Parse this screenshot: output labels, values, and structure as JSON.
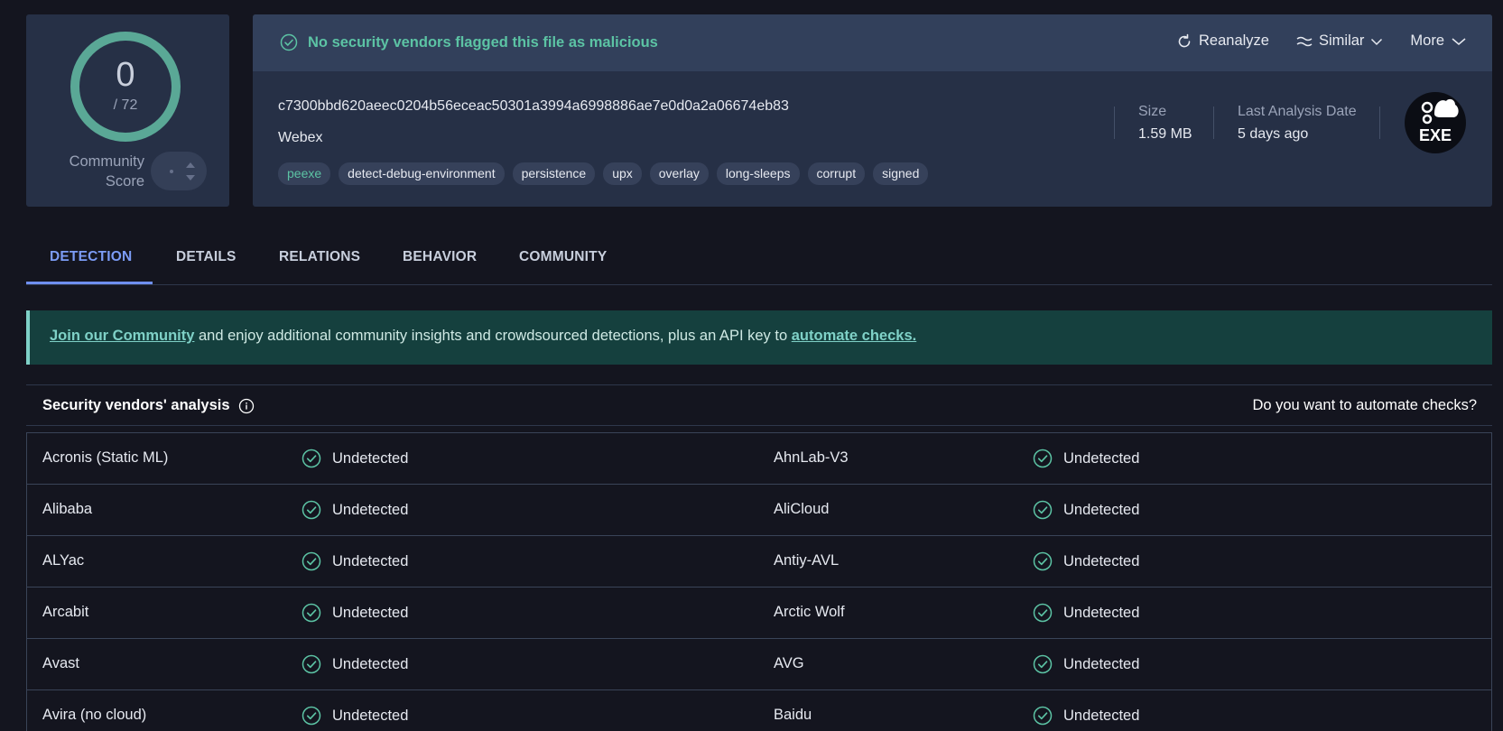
{
  "score": {
    "detections": "0",
    "total": "/ 72",
    "community_label_line1": "Community",
    "community_label_line2": "Score",
    "ring_color": "#5aa896"
  },
  "summary": {
    "status_message": "No security vendors flagged this file as malicious",
    "status_color": "#5cc3a4",
    "actions": {
      "reanalyze": "Reanalyze",
      "similar": "Similar",
      "more": "More"
    },
    "hash": "c7300bbd620aeec0204b56eceac50301a3994a6998886ae7e0d0a2a06674eb83",
    "file_name": "Webex",
    "tags": [
      "peexe",
      "detect-debug-environment",
      "persistence",
      "upx",
      "overlay",
      "long-sleeps",
      "corrupt",
      "signed"
    ],
    "size_label": "Size",
    "size_value": "1.59 MB",
    "date_label": "Last Analysis Date",
    "date_value": "5 days ago",
    "file_type": "EXE"
  },
  "tabs": [
    "DETECTION",
    "DETAILS",
    "RELATIONS",
    "BEHAVIOR",
    "COMMUNITY"
  ],
  "banner": {
    "link1": "Join our Community",
    "middle": " and enjoy additional community insights and crowdsourced detections, plus an API key to ",
    "link2": "automate checks."
  },
  "vendors": {
    "title": "Security vendors' analysis",
    "automate_question": "Do you want to automate checks?",
    "rows": [
      {
        "left_name": "Acronis (Static ML)",
        "left_result": "Undetected",
        "right_name": "AhnLab-V3",
        "right_result": "Undetected"
      },
      {
        "left_name": "Alibaba",
        "left_result": "Undetected",
        "right_name": "AliCloud",
        "right_result": "Undetected"
      },
      {
        "left_name": "ALYac",
        "left_result": "Undetected",
        "right_name": "Antiy-AVL",
        "right_result": "Undetected"
      },
      {
        "left_name": "Arcabit",
        "left_result": "Undetected",
        "right_name": "Arctic Wolf",
        "right_result": "Undetected"
      },
      {
        "left_name": "Avast",
        "left_result": "Undetected",
        "right_name": "AVG",
        "right_result": "Undetected"
      },
      {
        "left_name": "Avira (no cloud)",
        "left_result": "Undetected",
        "right_name": "Baidu",
        "right_result": "Undetected"
      }
    ]
  }
}
